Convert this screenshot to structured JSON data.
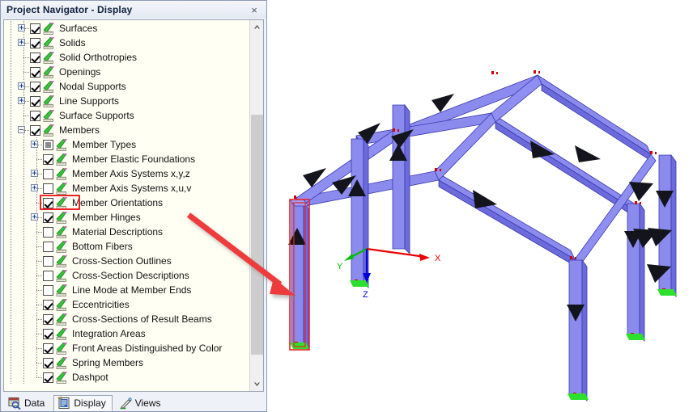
{
  "window": {
    "title": "Project Navigator - Display",
    "close_label": "×",
    "close_icon": "close-icon"
  },
  "tree": {
    "items": [
      {
        "label": "Surfaces",
        "indent": 1,
        "check": "checked",
        "expander": "plus",
        "guide": "tee"
      },
      {
        "label": "Solids",
        "indent": 1,
        "check": "checked",
        "expander": "plus",
        "guide": "tee"
      },
      {
        "label": "Solid Orthotropies",
        "indent": 1,
        "check": "checked",
        "expander": "none",
        "guide": "tee"
      },
      {
        "label": "Openings",
        "indent": 1,
        "check": "checked",
        "expander": "none",
        "guide": "tee"
      },
      {
        "label": "Nodal Supports",
        "indent": 1,
        "check": "checked",
        "expander": "plus",
        "guide": "tee"
      },
      {
        "label": "Line Supports",
        "indent": 1,
        "check": "checked",
        "expander": "plus",
        "guide": "tee"
      },
      {
        "label": "Surface Supports",
        "indent": 1,
        "check": "checked",
        "expander": "none",
        "guide": "tee"
      },
      {
        "label": "Members",
        "indent": 1,
        "check": "checked",
        "expander": "minus",
        "guide": "tee"
      },
      {
        "label": "Member Types",
        "indent": 2,
        "check": "partial",
        "expander": "plus",
        "guide": "tee"
      },
      {
        "label": "Member Elastic Foundations",
        "indent": 2,
        "check": "checked",
        "expander": "none",
        "guide": "tee"
      },
      {
        "label": "Member Axis Systems x,y,z",
        "indent": 2,
        "check": "unchecked",
        "expander": "plus",
        "guide": "tee"
      },
      {
        "label": "Member Axis Systems x,u,v",
        "indent": 2,
        "check": "unchecked",
        "expander": "plus",
        "guide": "tee"
      },
      {
        "label": "Member Orientations",
        "indent": 2,
        "check": "checked",
        "expander": "none",
        "guide": "tee",
        "highlighted": true
      },
      {
        "label": "Member Hinges",
        "indent": 2,
        "check": "checked",
        "expander": "plus",
        "guide": "tee"
      },
      {
        "label": "Material Descriptions",
        "indent": 2,
        "check": "unchecked",
        "expander": "none",
        "guide": "tee"
      },
      {
        "label": "Bottom Fibers",
        "indent": 2,
        "check": "unchecked",
        "expander": "none",
        "guide": "tee"
      },
      {
        "label": "Cross-Section Outlines",
        "indent": 2,
        "check": "unchecked",
        "expander": "none",
        "guide": "tee"
      },
      {
        "label": "Cross-Section Descriptions",
        "indent": 2,
        "check": "unchecked",
        "expander": "none",
        "guide": "tee"
      },
      {
        "label": "Line Mode at Member Ends",
        "indent": 2,
        "check": "unchecked",
        "expander": "none",
        "guide": "tee"
      },
      {
        "label": "Eccentricities",
        "indent": 2,
        "check": "checked",
        "expander": "none",
        "guide": "tee"
      },
      {
        "label": "Cross-Sections of Result Beams",
        "indent": 2,
        "check": "checked",
        "expander": "none",
        "guide": "tee"
      },
      {
        "label": "Integration Areas",
        "indent": 2,
        "check": "checked",
        "expander": "none",
        "guide": "tee"
      },
      {
        "label": "Front Areas Distinguished by Color",
        "indent": 2,
        "check": "checked",
        "expander": "none",
        "guide": "tee"
      },
      {
        "label": "Spring Members",
        "indent": 2,
        "check": "checked",
        "expander": "none",
        "guide": "tee"
      },
      {
        "label": "Dashpot",
        "indent": 2,
        "check": "checked",
        "expander": "none",
        "guide": "last"
      }
    ],
    "item_icon": "pencil-ruler-icon",
    "scrollbar": {
      "up_icon": "chevron-up-icon",
      "down_icon": "chevron-down-icon"
    }
  },
  "tabs": [
    {
      "label": "Data",
      "icon": "data-magnifier-icon",
      "active": false
    },
    {
      "label": "Display",
      "icon": "display-sheet-icon",
      "active": true
    },
    {
      "label": "Views",
      "icon": "views-scope-icon",
      "active": false
    }
  ],
  "viewport": {
    "axes": {
      "x_label": "X",
      "y_label": "Y",
      "z_label": "Z"
    },
    "colors": {
      "member_face_light": "#8f8ff0",
      "member_face_mid": "#7b7ae8",
      "member_face_dark": "#6a69d9",
      "member_edge": "#3a39b0",
      "arrow": "#101018",
      "node_marker": "#cc0000",
      "support": "#2ee02e",
      "highlight": "#ee2222",
      "axis_x": "#ee0000",
      "axis_y": "#00c000",
      "axis_z": "#0000dd"
    },
    "model": {
      "description": "3D portal frame with member orientation arrows",
      "highlighted_member": "front-left-column"
    }
  },
  "annotation": {
    "arrow_color": "#ee3333",
    "from": "member-orientations-tree-item",
    "to": "highlighted-column"
  }
}
